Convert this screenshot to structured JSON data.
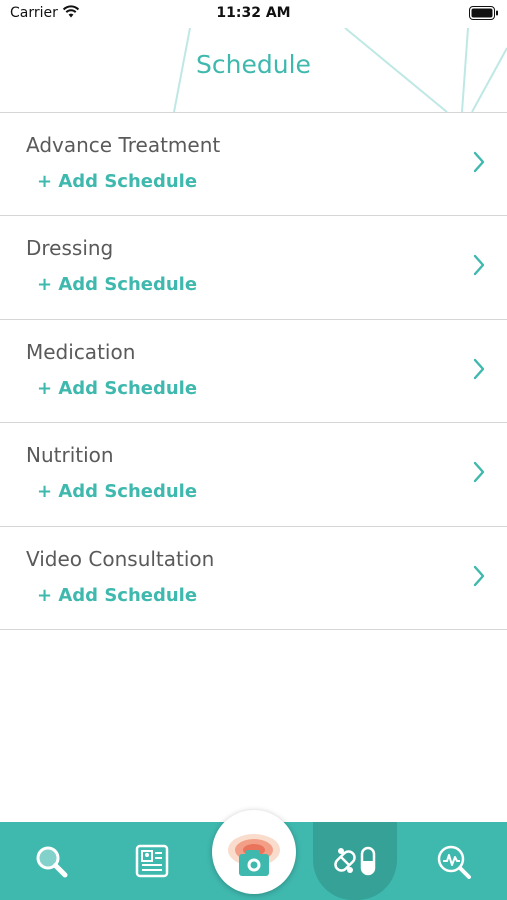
{
  "status_bar": {
    "carrier": "Carrier",
    "time": "11:32 AM",
    "icons": [
      "wifi-icon",
      "battery-icon"
    ]
  },
  "header": {
    "title": "Schedule"
  },
  "schedule_items": [
    {
      "title": "Advance Treatment",
      "action": "+ Add Schedule"
    },
    {
      "title": "Dressing",
      "action": "+ Add Schedule"
    },
    {
      "title": "Medication",
      "action": "+ Add Schedule"
    },
    {
      "title": "Nutrition",
      "action": "+ Add Schedule"
    },
    {
      "title": "Video Consultation",
      "action": "+ Add Schedule"
    }
  ],
  "tab_bar": {
    "tabs": [
      {
        "icon": "search-icon",
        "active": false
      },
      {
        "icon": "profile-card-icon",
        "active": false
      },
      {
        "icon": "camera-icon",
        "active": false
      },
      {
        "icon": "medication-icon",
        "active": true
      },
      {
        "icon": "analytics-icon",
        "active": false
      }
    ]
  },
  "colors": {
    "accent": "#3fb8ae",
    "accent_dark": "#35a197",
    "title_text": "#5a5a5a",
    "divider": "#d6d6d6",
    "camera_highlight": "#f08a6e"
  }
}
